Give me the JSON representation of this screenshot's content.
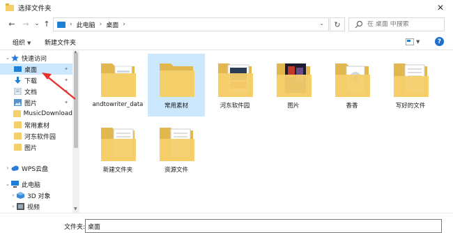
{
  "window": {
    "title": "选择文件夹",
    "close_glyph": "✕"
  },
  "nav": {
    "back_glyph": "←",
    "forward_glyph": "→",
    "dropdown_glyph": "⌄",
    "up_glyph": "↑",
    "breadcrumb": [
      "此电脑",
      "桌面"
    ],
    "refresh_glyph": "↻",
    "search_placeholder": "在 桌面 中搜索"
  },
  "toolbar": {
    "organize_label": "组织",
    "new_folder_label": "新建文件夹",
    "help_glyph": "?"
  },
  "sidebar": {
    "items": [
      {
        "label": "快速访问",
        "icon": "star-icon",
        "chevron": "⌄"
      },
      {
        "label": "桌面",
        "icon": "desktop-icon",
        "pinned": true,
        "selected": true
      },
      {
        "label": "下载",
        "icon": "download-icon",
        "pinned": true
      },
      {
        "label": "文档",
        "icon": "document-icon",
        "pinned": true
      },
      {
        "label": "图片",
        "icon": "picture-icon",
        "pinned": true
      },
      {
        "label": "MusicDownload",
        "icon": "folder-icon"
      },
      {
        "label": "常用素材",
        "icon": "folder-icon"
      },
      {
        "label": "河东软件园",
        "icon": "folder-icon"
      },
      {
        "label": "图片",
        "icon": "folder-icon"
      },
      {
        "label": "WPS云盘",
        "icon": "cloud-icon",
        "chevron": "›"
      },
      {
        "label": "此电脑",
        "icon": "computer-icon",
        "chevron": "⌄"
      },
      {
        "label": "3D 对象",
        "icon": "3d-objects-icon",
        "chevron": "›"
      },
      {
        "label": "视频",
        "icon": "video-icon",
        "chevron": "›"
      }
    ],
    "pin_glyph": "📌"
  },
  "files": [
    {
      "name": "andtowriter_data",
      "type": "folder-with-docs"
    },
    {
      "name": "常用素材",
      "type": "folder-empty",
      "selected": true
    },
    {
      "name": "河东软件园",
      "type": "folder-with-screens"
    },
    {
      "name": "图片",
      "type": "folder-with-photos"
    },
    {
      "name": "香香",
      "type": "folder-with-media"
    },
    {
      "name": "写好的文件",
      "type": "folder-with-papers"
    },
    {
      "name": "新建文件夹",
      "type": "folder-with-docs"
    },
    {
      "name": "资源文件",
      "type": "folder-with-papers"
    }
  ],
  "footer": {
    "folder_label": "文件夹:",
    "folder_value": "桌面"
  },
  "colors": {
    "accent": "#1e7fd6",
    "selection": "#cce8ff",
    "folder": "#f5cf6a",
    "annotation_arrow": "#e8322f"
  }
}
